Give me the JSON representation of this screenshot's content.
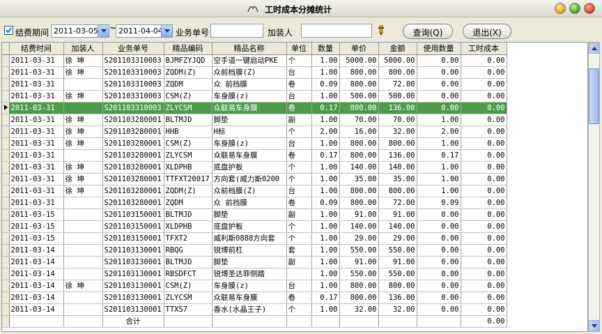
{
  "window": {
    "title": "工时成本分摊统计"
  },
  "filters": {
    "checkbox_label": "结费期间",
    "checked": true,
    "date_from": "2011-03-05",
    "tilde": "~",
    "date_to": "2011-04-04",
    "business_no_label": "业务单号",
    "business_no_value": "",
    "installer_label": "加装人",
    "installer_value": ""
  },
  "buttons": {
    "query": "查询(Q)",
    "exit": "退出(X)"
  },
  "table": {
    "columns": [
      "结费时间",
      "加装人",
      "业务单号",
      "精品编码",
      "精品名称",
      "单位",
      "数量",
      "单价",
      "金额",
      "使用数量",
      "工时成本"
    ],
    "selected_index": 4,
    "rows": [
      [
        "2011-03-31",
        "徐  坤",
        "S201103310003",
        "BJMFZYJQD",
        "空手道一键启动PKE",
        "个",
        "1.00",
        "5000.00",
        "5000.00",
        "0.00",
        "0.00"
      ],
      [
        "2011-03-31",
        "徐  坤",
        "S201103310003",
        "ZQDM(Z)",
        "众前档膜(Z)",
        "台",
        "1.00",
        "800.00",
        "800.00",
        "0.00",
        "0.00"
      ],
      [
        "2011-03-31",
        "",
        "S201103310003",
        "ZQDM",
        "众 前挡膜",
        "卷",
        "0.09",
        "800.00",
        "72.00",
        "0.00",
        "0.00"
      ],
      [
        "2011-03-31",
        "徐  坤",
        "S201103310003",
        "CSM(Z)",
        "车身膜(z)",
        "台",
        "1.00",
        "500.00",
        "500.00",
        "0.00",
        "0.00"
      ],
      [
        "2011-03-31",
        "",
        "S201103310003",
        "ZLYCSM",
        "众联易车身膜",
        "卷",
        "0.17",
        "800.00",
        "136.00",
        "0.00",
        "0.00"
      ],
      [
        "2011-03-31",
        "徐  坤",
        "S201103280001",
        "BLTMJD",
        "脚垫",
        "副",
        "1.00",
        "70.00",
        "70.00",
        "1.00",
        "0.00"
      ],
      [
        "2011-03-31",
        "徐  坤",
        "S201103280001",
        "HHB",
        "H标",
        "个",
        "2.00",
        "16.00",
        "32.00",
        "2.00",
        "0.00"
      ],
      [
        "2011-03-31",
        "徐  坤",
        "S201103280001",
        "CSM(Z)",
        "车身膜(z)",
        "台",
        "1.00",
        "800.00",
        "800.00",
        "1.00",
        "0.00"
      ],
      [
        "2011-03-31",
        "",
        "S201103280001",
        "ZLYCSM",
        "众联易车身膜",
        "卷",
        "0.17",
        "800.00",
        "136.00",
        "0.17",
        "0.00"
      ],
      [
        "2011-03-31",
        "徐  坤",
        "S201103280001",
        "XLDPHB",
        "底盘护板",
        "个",
        "1.00",
        "140.00",
        "140.00",
        "1.00",
        "0.00"
      ],
      [
        "2011-03-31",
        "徐  坤",
        "S201103280001",
        "TTFXT20017",
        "方向套(威力斯0200",
        "个",
        "1.00",
        "35.00",
        "35.00",
        "1.00",
        "0.00"
      ],
      [
        "2011-03-31",
        "徐  坤",
        "S201103280001",
        "ZQDM(Z)",
        "众前档膜(Z)",
        "台",
        "1.00",
        "800.00",
        "800.00",
        "1.00",
        "0.00"
      ],
      [
        "2011-03-31",
        "",
        "S201103280001",
        "ZQDM",
        "众 前挡膜",
        "卷",
        "0.09",
        "800.00",
        "72.00",
        "0.09",
        "0.00"
      ],
      [
        "2011-03-15",
        "",
        "S201103150001",
        "BLTMJD",
        "脚垫",
        "副",
        "1.00",
        "91.00",
        "91.00",
        "0.00",
        "0.00"
      ],
      [
        "2011-03-15",
        "",
        "S201103150001",
        "XLDPHB",
        "底盘护板",
        "个",
        "1.00",
        "140.00",
        "140.00",
        "0.00",
        "0.00"
      ],
      [
        "2011-03-15",
        "",
        "S201103150001",
        "TFXT2",
        "威利斯0888方向套",
        "个",
        "1.00",
        "29.00",
        "29.00",
        "0.00",
        "0.00"
      ],
      [
        "2011-03-14",
        "",
        "S201103130001",
        "RBQG",
        "锐博前杠",
        "套",
        "1.00",
        "550.00",
        "550.00",
        "0.00",
        "0.00"
      ],
      [
        "2011-03-14",
        "",
        "S201103130001",
        "BLTMJD",
        "脚垫",
        "副",
        "1.00",
        "91.00",
        "91.00",
        "0.00",
        "0.00"
      ],
      [
        "2011-03-14",
        "",
        "S201103130001",
        "RBSDFCT",
        "锐博圣达菲侧踏",
        "",
        "1.00",
        "550.00",
        "550.00",
        "0.00",
        "0.00"
      ],
      [
        "2011-03-14",
        "徐  坤",
        "S201103130001",
        "CSM(Z)",
        "车身膜(z)",
        "台",
        "1.00",
        "800.00",
        "800.00",
        "0.00",
        "0.00"
      ],
      [
        "2011-03-14",
        "",
        "S201103130001",
        "ZLYCSM",
        "众联易车身膜",
        "卷",
        "0.17",
        "800.00",
        "136.00",
        "0.00",
        "0.00"
      ],
      [
        "2011-03-14",
        "",
        "S201103130001",
        "TTXS7",
        "香水(水晶王子)",
        "个",
        "1.00",
        "32.00",
        "32.00",
        "0.00",
        "0.00"
      ]
    ],
    "total": {
      "label": "合计",
      "value": "0.00"
    }
  },
  "colors": {
    "selection": "#4c9c4c",
    "header_bg": "#ece9d8",
    "border": "#7f9db9"
  }
}
